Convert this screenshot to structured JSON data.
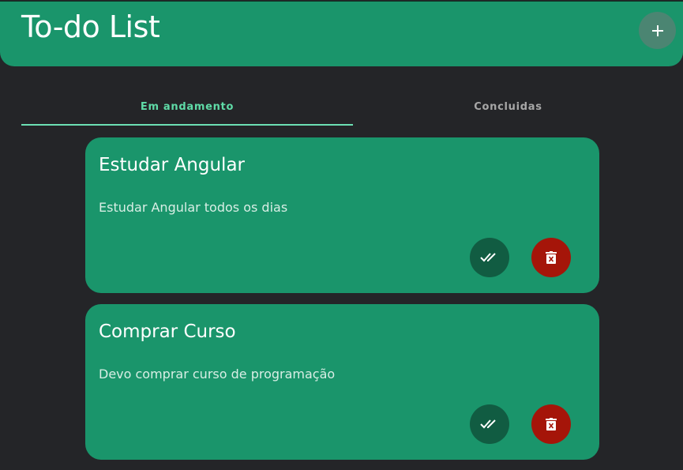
{
  "header": {
    "title": "To-do List",
    "add_icon": "plus-icon"
  },
  "tabs": [
    {
      "label": "Em andamento",
      "active": true
    },
    {
      "label": "Concluidas",
      "active": false
    }
  ],
  "tasks": [
    {
      "title": "Estudar Angular",
      "description": "Estudar Angular todos os dias",
      "complete_icon": "double-check-icon",
      "delete_icon": "trash-icon"
    },
    {
      "title": "Comprar Curso",
      "description": "Devo comprar curso de programação",
      "complete_icon": "double-check-icon",
      "delete_icon": "trash-icon"
    }
  ],
  "colors": {
    "background": "#242528",
    "primary": "#1a956b",
    "accent": "#5fdba7",
    "complete_button": "#115c42",
    "delete_button": "#a51509"
  }
}
